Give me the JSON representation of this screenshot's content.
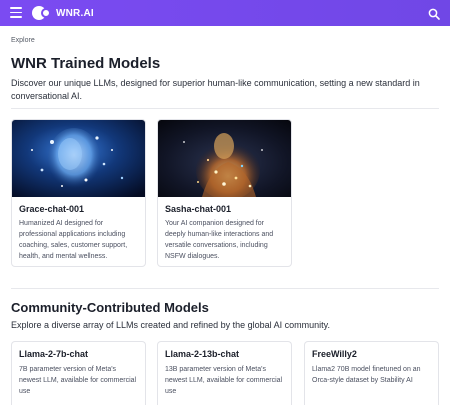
{
  "header": {
    "brand": "WNR.AI",
    "menu_icon": "hamburger-menu-icon",
    "search_icon": "search-icon",
    "bg_color": "#7b4bf2"
  },
  "breadcrumb": "Explore",
  "trained": {
    "title": "WNR Trained Models",
    "description": "Discover our unique LLMs, designed for superior human-like communication, setting a new standard in conversational AI.",
    "cards": [
      {
        "title": "Grace-chat-001",
        "description": "Humanized AI designed for professional applications including coaching, sales, customer support, health, and mental wellness."
      },
      {
        "title": "Sasha-chat-001",
        "description": "Your AI companion designed for deeply human-like interactions and versatile conversations, including NSFW dialogues."
      }
    ]
  },
  "community": {
    "title": "Community-Contributed Models",
    "description": "Explore a diverse array of LLMs created and refined by the global AI community.",
    "cards": [
      {
        "title": "Llama-2-7b-chat",
        "description": "7B parameter version of Meta's newest LLM, available for commercial use"
      },
      {
        "title": "Llama-2-13b-chat",
        "description": "13B parameter version of Meta's newest LLM, available for commercial use"
      },
      {
        "title": "FreeWilly2",
        "description": "Llama2 70B model finetuned on an Orca-style dataset by Stability AI"
      }
    ]
  }
}
